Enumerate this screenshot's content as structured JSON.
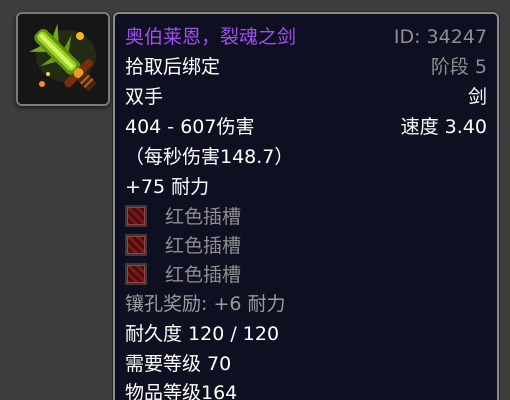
{
  "item": {
    "name": "奥伯莱恩，裂魂之剑",
    "id_label": "ID: 34247",
    "bind": "拾取后绑定",
    "phase": "阶段 5",
    "slot": "双手",
    "type": "剑",
    "damage": "404 - 607伤害",
    "speed": "速度 3.40",
    "dps": "（每秒伤害148.7）",
    "stat": "+75 耐力",
    "sockets": [
      "红色插槽",
      "红色插槽",
      "红色插槽"
    ],
    "socket_bonus": "镶孔奖励:  +6 耐力",
    "durability": "耐久度 120 / 120",
    "required_level": "需要等级 70",
    "item_level": "物品等级164"
  },
  "colors": {
    "name_color": "#a24bf2",
    "meta_color": "#8e8e8e",
    "text_color": "#ffffff",
    "socket_color": "#7b1a1a",
    "panel_bg": "#0e1022"
  },
  "icons": {
    "item_icon": "sword-icon",
    "socket_icon": "red-socket-icon"
  }
}
